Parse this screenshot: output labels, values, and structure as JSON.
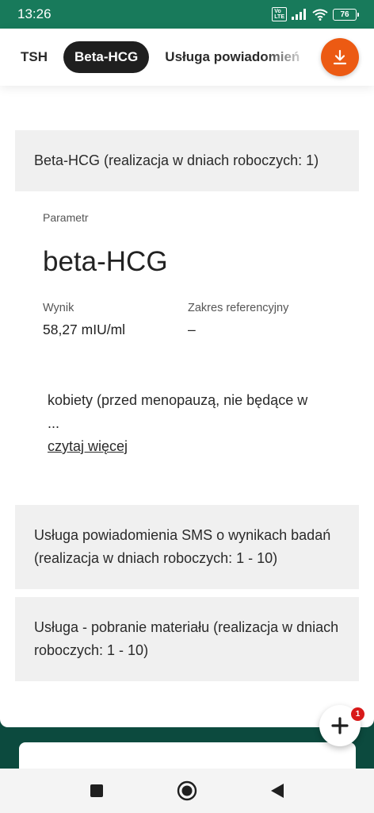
{
  "status_bar": {
    "time": "13:26",
    "battery": "76"
  },
  "tabs": [
    {
      "label": "TSH",
      "active": false
    },
    {
      "label": "Beta-HCG",
      "active": true
    },
    {
      "label": "Usługa powiadomień",
      "active": false
    }
  ],
  "sections": {
    "beta_hcg": "Beta-HCG (realizacja w dniach roboczych: 1)",
    "sms": "Usługa powiadomienia SMS o wynikach badań (realizacja w dniach roboczych: 1 - 10)",
    "material": "Usługa - pobranie materiału (realizacja w dniach roboczych: 1 - 10)"
  },
  "result": {
    "param_label": "Parametr",
    "param_name": "beta-HCG",
    "result_label": "Wynik",
    "result_value": "58,27 mIU/ml",
    "range_label": "Zakres referencyjny",
    "range_value": "–"
  },
  "description": {
    "text": "kobiety (przed menopauzą, nie będące w",
    "ellipsis": "...",
    "read_more": "czytaj więcej"
  },
  "fab": {
    "badge": "1"
  },
  "colors": {
    "status_bar": "#187a5b",
    "background": "#0c4a3e",
    "accent_orange": "#ec5a13",
    "badge_red": "#d81a1a"
  },
  "icons": [
    "wifi-icon",
    "signal-icon",
    "download-icon",
    "plus-icon",
    "square-nav-icon",
    "home-nav-icon",
    "back-nav-icon"
  ]
}
